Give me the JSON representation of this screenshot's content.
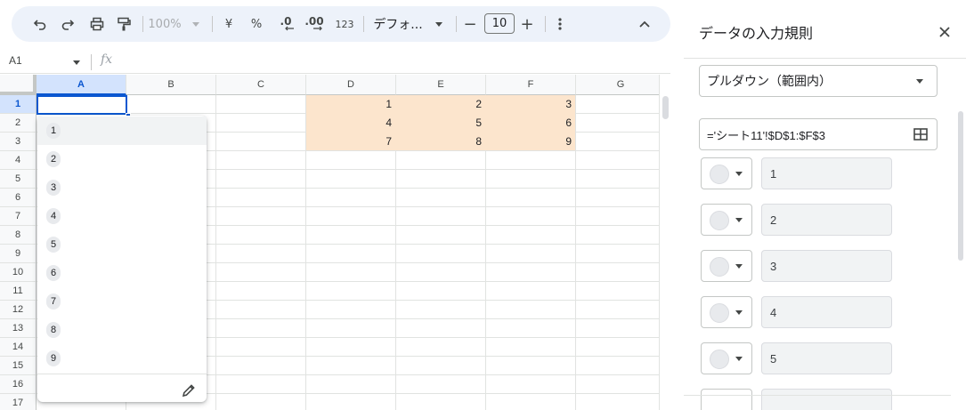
{
  "toolbar": {
    "zoom": "100%",
    "currency": "¥",
    "percent": "%",
    "decimal_decrease": ".0",
    "decimal_increase": ".00",
    "number_format": "123",
    "font": "デフォ...",
    "font_size": "10",
    "minus": "−",
    "plus": "+"
  },
  "formula_bar": {
    "name_box": "A1",
    "fx": "fx"
  },
  "grid": {
    "columns": [
      "A",
      "B",
      "C",
      "D",
      "E",
      "F",
      "G"
    ],
    "rows": [
      "1",
      "2",
      "3",
      "4",
      "5",
      "6",
      "7",
      "8",
      "9",
      "10",
      "11",
      "12",
      "13",
      "14",
      "15",
      "16",
      "17"
    ],
    "values": [
      [
        "1",
        "2",
        "3"
      ],
      [
        "4",
        "5",
        "6"
      ],
      [
        "7",
        "8",
        "9"
      ]
    ],
    "highlight_color": "#fce5cd",
    "selection_color": "#0b57d0"
  },
  "dropdown": {
    "items": [
      "1",
      "2",
      "3",
      "4",
      "5",
      "6",
      "7",
      "8",
      "9"
    ]
  },
  "panel": {
    "title": "データの入力規則",
    "criteria": "プルダウン（範囲内）",
    "range": "='シート11'!$D$1:$F$3",
    "options": [
      "1",
      "2",
      "3",
      "4",
      "5"
    ]
  }
}
